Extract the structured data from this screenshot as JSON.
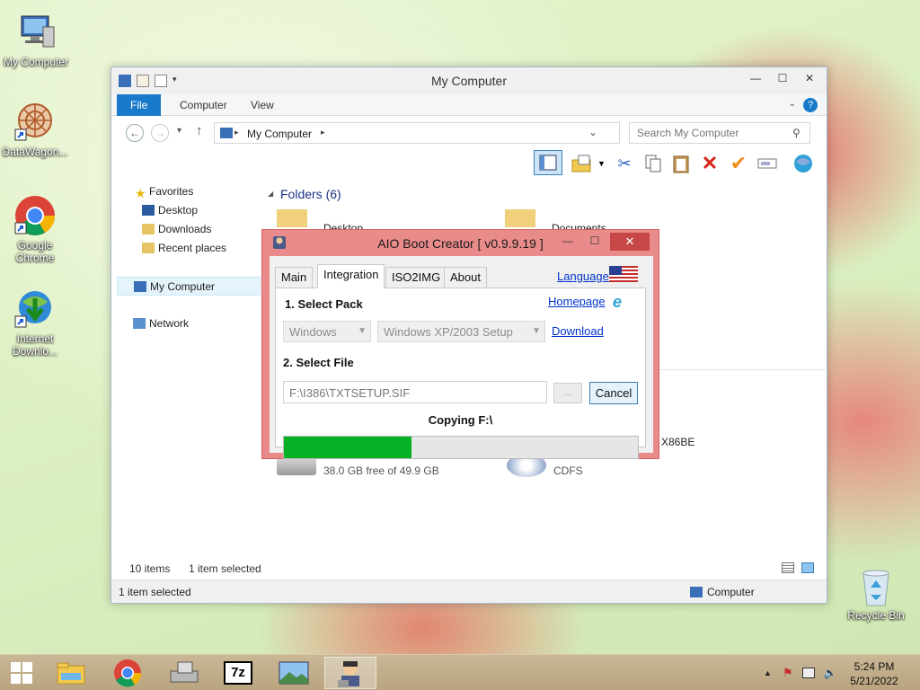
{
  "desktop": {
    "icons": [
      {
        "label": "My Computer"
      },
      {
        "label": "DataWagon..."
      },
      {
        "label": "Google Chrome"
      },
      {
        "label": "Internet Downlo..."
      },
      {
        "label": "Recycle Bin"
      }
    ]
  },
  "explorer": {
    "title": "My Computer",
    "tabs": [
      "File",
      "Computer",
      "View"
    ],
    "address": "My Computer",
    "search_placeholder": "Search My Computer",
    "nav": {
      "favorites": "Favorites",
      "desktop": "Desktop",
      "downloads": "Downloads",
      "recent": "Recent places",
      "my_computer": "My Computer",
      "network": "Network"
    },
    "folders_header": "Folders (6)",
    "items": {
      "desktop": "Desktop",
      "documents": "Documents",
      "drive_free": "38.0 GB free of 49.9 GB",
      "x86be": "X86BE",
      "cdfs": "CDFS"
    },
    "status": {
      "item_count": "10 items",
      "selected": "1 item selected"
    },
    "bottom": {
      "left": "1 item selected",
      "right": "Computer"
    }
  },
  "aio": {
    "title": "AIO Boot Creator [ v0.9.9.19 ]",
    "tabs": [
      "Main",
      "Integration",
      "ISO2IMG",
      "About"
    ],
    "language_link": "Language",
    "homepage_link": "Homepage",
    "download_link": "Download",
    "select_pack_label": "1. Select Pack",
    "pack_value": "Windows",
    "setup_value": "Windows XP/2003 Setup",
    "select_file_label": "2. Select File",
    "file_path": "F:\\I386\\TXTSETUP.SIF",
    "browse_label": "...",
    "cancel_label": "Cancel",
    "copy_status": "Copying F:\\",
    "progress": 0.36
  },
  "taskbar": {
    "apps": [
      "File Explorer",
      "Google Chrome",
      "Drive Tool",
      "7-Zip",
      "Photos",
      "AIO Boot Creator"
    ],
    "time": "5:24 PM",
    "date": "5/21/2022"
  }
}
